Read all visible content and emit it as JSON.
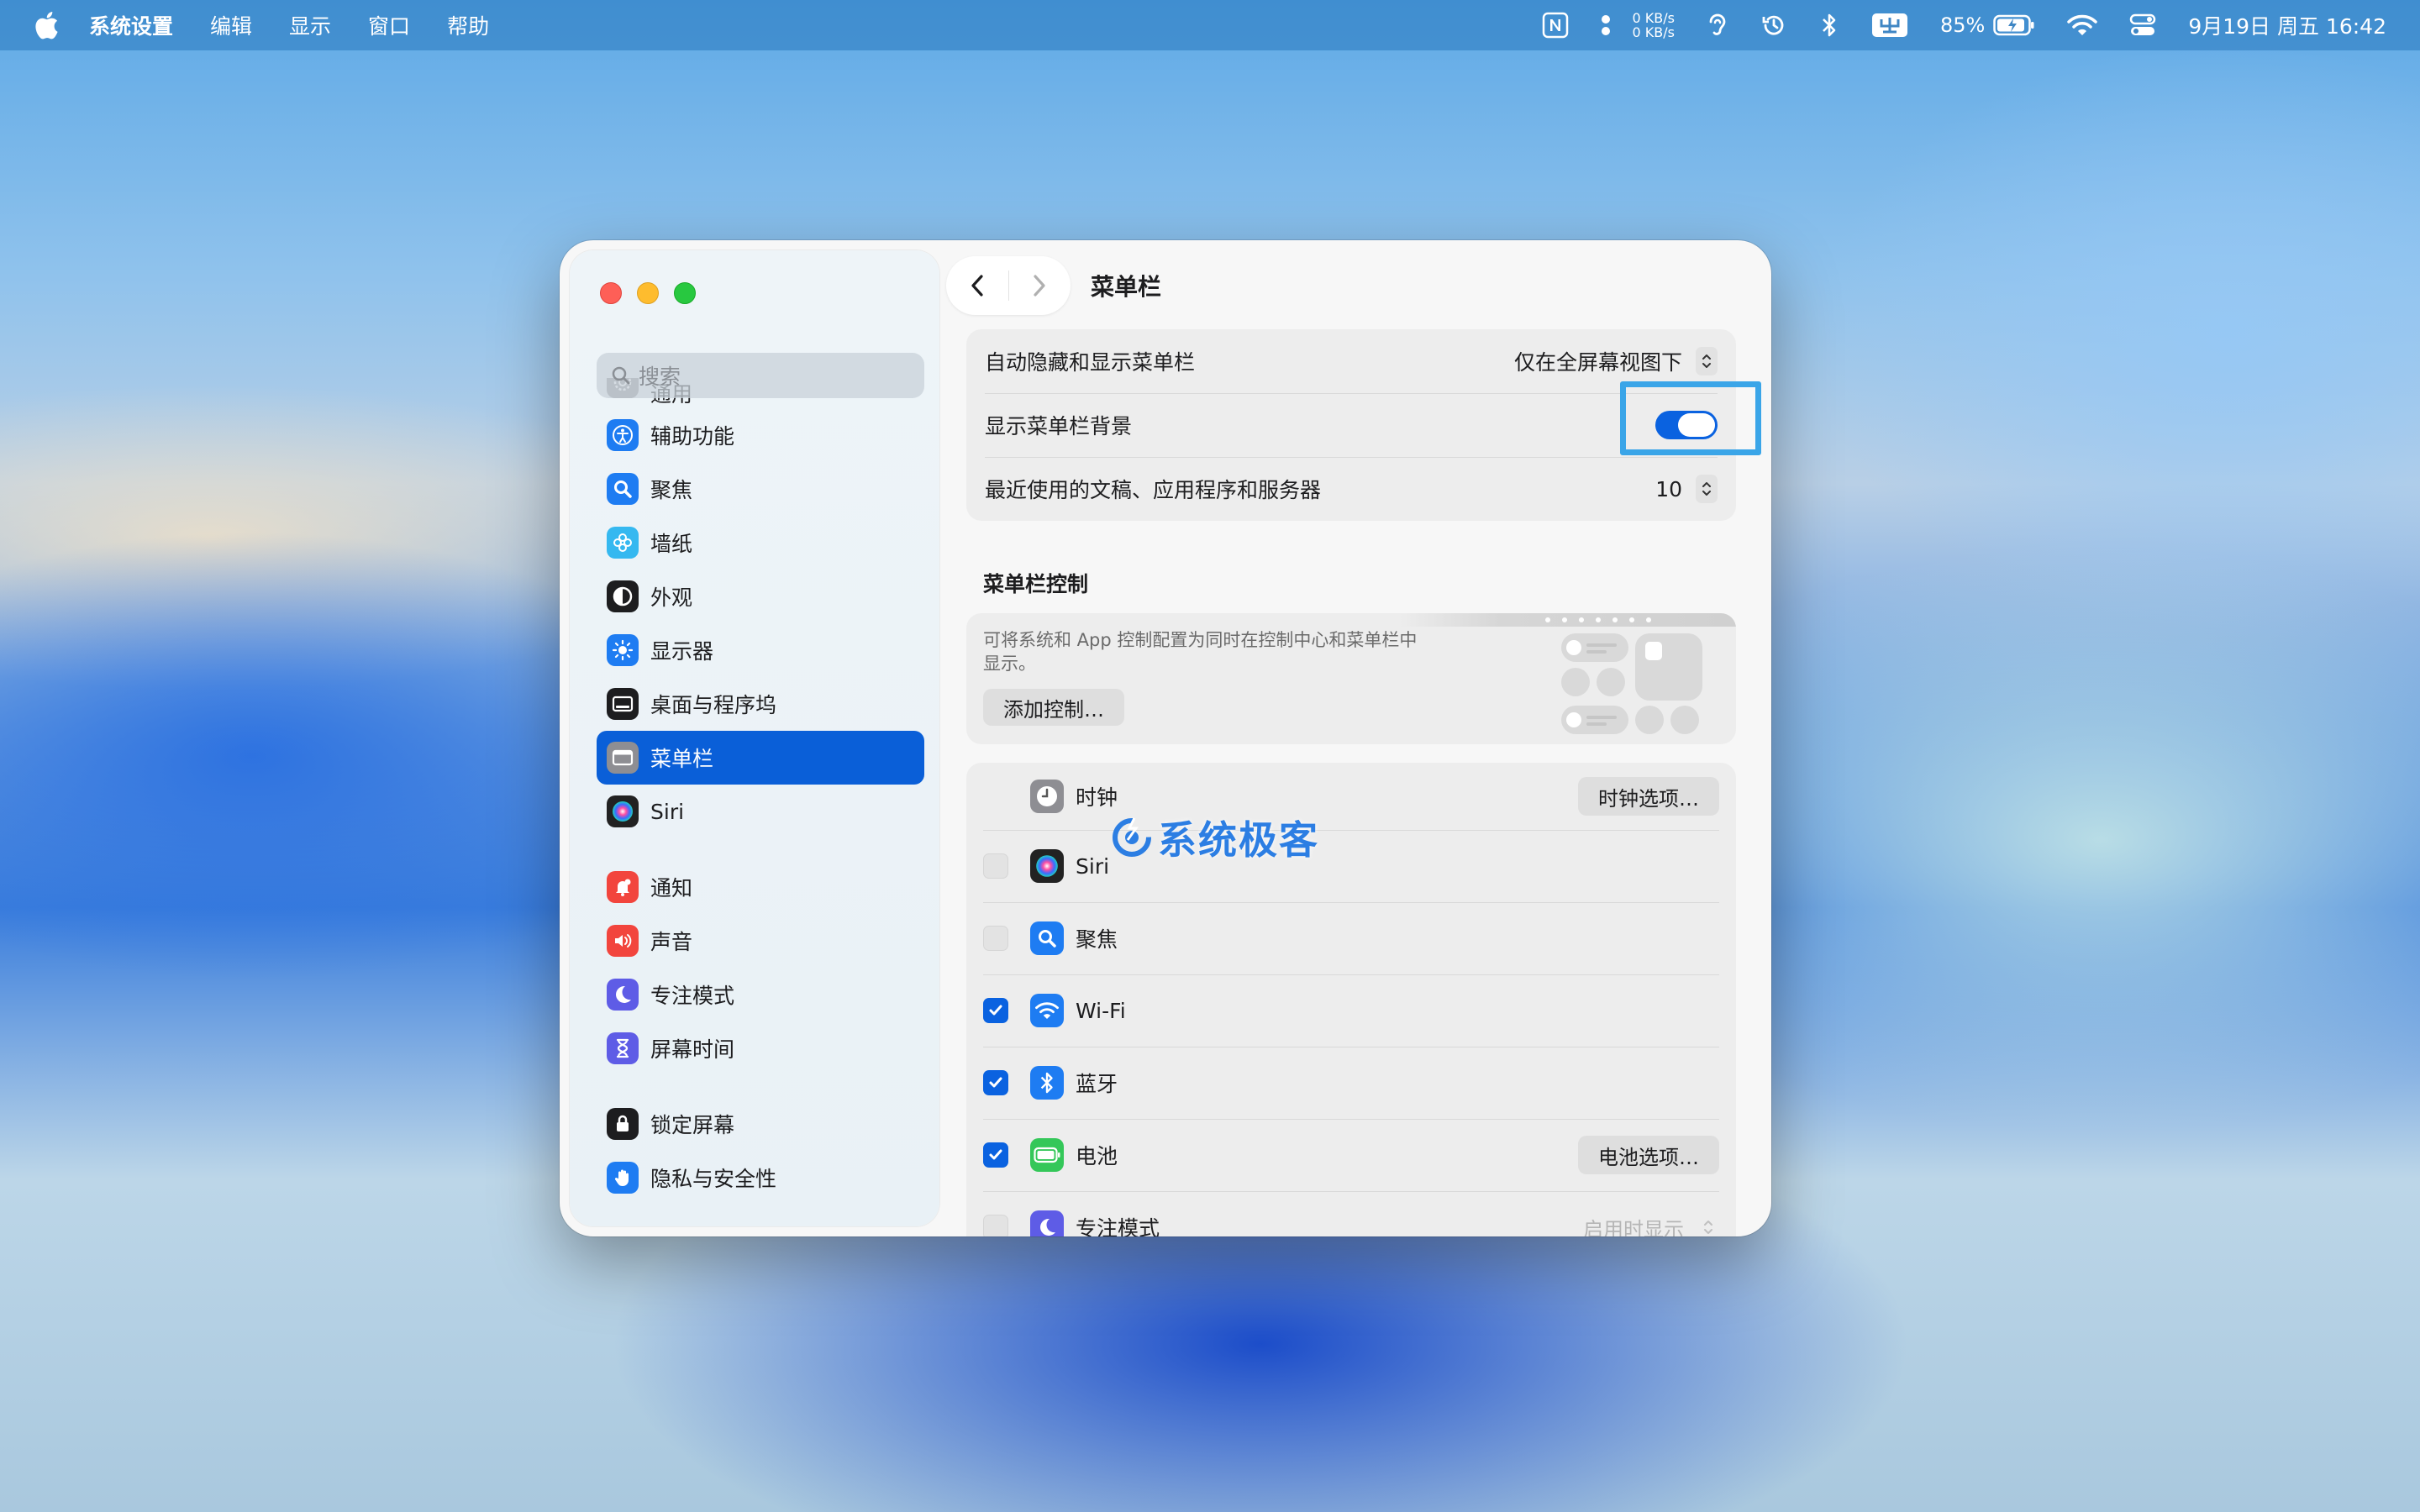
{
  "menubar": {
    "app_name": "系统设置",
    "menus": [
      "编辑",
      "显示",
      "窗口",
      "帮助"
    ],
    "net_up": "0 KB/s",
    "net_down": "0 KB/s",
    "battery_percent": "85%",
    "datetime": "9月19日 周五  16:42"
  },
  "sidebar": {
    "search_placeholder": "搜索",
    "items": [
      {
        "label": "通用",
        "icon": "gear-icon",
        "color": "#8e8e93"
      },
      {
        "label": "辅助功能",
        "icon": "accessibility-icon",
        "color": "#1e7cf2"
      },
      {
        "label": "聚焦",
        "icon": "spotlight-icon",
        "color": "#1e7cf2"
      },
      {
        "label": "墙纸",
        "icon": "wallpaper-icon",
        "color": "#35b8f0"
      },
      {
        "label": "外观",
        "icon": "appearance-icon",
        "color": "#1d1d1f"
      },
      {
        "label": "显示器",
        "icon": "display-icon",
        "color": "#1e7cf2"
      },
      {
        "label": "桌面与程序坞",
        "icon": "dock-icon",
        "color": "#1d1d1f"
      },
      {
        "label": "菜单栏",
        "icon": "menubar-icon",
        "color": "#8e8e93"
      },
      {
        "label": "Siri",
        "icon": "siri-icon",
        "color": "#222222"
      },
      {
        "label": "通知",
        "icon": "bell-icon",
        "color": "#f2453d"
      },
      {
        "label": "声音",
        "icon": "speaker-icon",
        "color": "#f2453d"
      },
      {
        "label": "专注模式",
        "icon": "moon-icon",
        "color": "#5e5ce6"
      },
      {
        "label": "屏幕时间",
        "icon": "hourglass-icon",
        "color": "#5e5ce6"
      },
      {
        "label": "锁定屏幕",
        "icon": "lock-icon",
        "color": "#1d1d1f"
      },
      {
        "label": "隐私与安全性",
        "icon": "hand-icon",
        "color": "#1e7cf2"
      }
    ],
    "active_index": 7
  },
  "page": {
    "title": "菜单栏",
    "settings": {
      "autohide_label": "自动隐藏和显示菜单栏",
      "autohide_value": "仅在全屏幕视图下",
      "show_bg_label": "显示菜单栏背景",
      "show_bg_on": true,
      "recent_label": "最近使用的文稿、应用程序和服务器",
      "recent_value": "10"
    },
    "section_title": "菜单栏控制",
    "promo": {
      "text": "可将系统和 App 控制配置为同时在控制中心和菜单栏中显示。",
      "button": "添加控制…"
    },
    "controls": [
      {
        "label": "时钟",
        "icon": "clock-icon",
        "checked": null,
        "option": "时钟选项…"
      },
      {
        "label": "Siri",
        "icon": "siri-icon",
        "checked": false,
        "option": ""
      },
      {
        "label": "聚焦",
        "icon": "spotlight-icon",
        "checked": false,
        "option": ""
      },
      {
        "label": "Wi-Fi",
        "icon": "wifi-icon",
        "checked": true,
        "option": ""
      },
      {
        "label": "蓝牙",
        "icon": "bluetooth-icon",
        "checked": true,
        "option": ""
      },
      {
        "label": "电池",
        "icon": "battery-icon",
        "checked": true,
        "option": "电池选项…"
      },
      {
        "label": "专注模式",
        "icon": "moon-icon",
        "checked": false,
        "option": "启用时显示"
      }
    ]
  },
  "watermark": "系统极客"
}
